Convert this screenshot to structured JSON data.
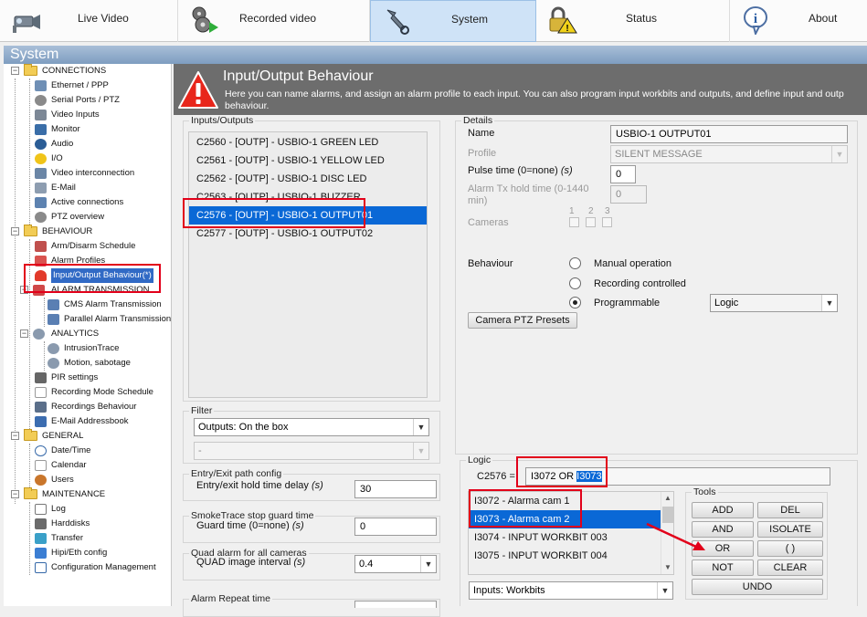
{
  "nav": {
    "tabs": [
      {
        "label": "Live Video",
        "icon": "camera-icon"
      },
      {
        "label": "Recorded video",
        "icon": "film-reel-icon"
      },
      {
        "label": "System",
        "icon": "wrench-icon"
      },
      {
        "label": "Status",
        "icon": "padlock-warning-icon"
      },
      {
        "label": "About",
        "icon": "info-bubble-icon"
      }
    ],
    "active": "System"
  },
  "system_title": "System",
  "tree": {
    "groups": [
      {
        "label": "CONNECTIONS",
        "items": [
          "Ethernet / PPP",
          "Serial Ports / PTZ",
          "Video Inputs",
          "Monitor",
          "Audio",
          "I/O",
          "Video interconnection",
          "E-Mail",
          "Active connections",
          "PTZ overview"
        ]
      },
      {
        "label": "BEHAVIOUR",
        "items": [
          "Arm/Disarm Schedule",
          "Alarm Profiles",
          "Input/Output Behaviour(*)",
          "ALARM TRANSMISSION",
          "CMS Alarm Transmission",
          "Parallel Alarm Transmission",
          "ANALYTICS",
          "IntrusionTrace",
          "Motion, sabotage",
          "PIR settings",
          "Recording Mode Schedule",
          "Recordings Behaviour",
          "E-Mail Addressbook"
        ]
      },
      {
        "label": "GENERAL",
        "items": [
          "Date/Time",
          "Calendar",
          "Users"
        ]
      },
      {
        "label": "MAINTENANCE",
        "items": [
          "Log",
          "Harddisks",
          "Transfer",
          "Hipi/Eth config",
          "Configuration Management"
        ]
      }
    ],
    "selected": "Input/Output Behaviour(*)"
  },
  "header": {
    "title": "Input/Output Behaviour",
    "description": "Here you can name alarms, and assign an alarm profile to each input. You can also program input workbits and outputs, and define input and outp behaviour."
  },
  "io": {
    "group_label": "Inputs/Outputs",
    "items": [
      "C2560 - [OUTP] - USBIO-1 GREEN LED",
      "C2561 - [OUTP] - USBIO-1 YELLOW LED",
      "C2562 - [OUTP] - USBIO-1 DISC LED",
      "C2563 - [OUTP] - USBIO-1 BUZZER",
      "C2576 - [OUTP] - USBIO-1 OUTPUT01",
      "C2577 - [OUTP] - USBIO-1 OUTPUT02"
    ],
    "selected_index": 4
  },
  "filter": {
    "group_label": "Filter",
    "primary": "Outputs: On the box",
    "secondary": "-"
  },
  "entry_exit": {
    "group_label": "Entry/Exit path config",
    "label": "Entry/exit hold time delay",
    "unit": "(s)",
    "value": "30"
  },
  "smoketrace": {
    "group_label": "SmokeTrace stop guard time",
    "label": "Guard time (0=none)",
    "unit": "(s)",
    "value": "0"
  },
  "quad": {
    "group_label": "Quad alarm for all cameras",
    "label": "QUAD image interval",
    "unit": "(s)",
    "value": "0.4"
  },
  "alarm_repeat": {
    "group_label": "Alarm Repeat time"
  },
  "details": {
    "group_label": "Details",
    "name_label": "Name",
    "name_value": "USBIO-1 OUTPUT01",
    "profile_label": "Profile",
    "profile_value": "SILENT MESSAGE",
    "pulse_label": "Pulse time (0=none)",
    "pulse_unit": "(s)",
    "pulse_value": "0",
    "alarm_tx_label": "Alarm Tx hold time (0-1440 min)",
    "alarm_tx_value": "0",
    "cameras_label": "Cameras",
    "camera_numbers": [
      "1",
      "2",
      "3"
    ],
    "behaviour_label": "Behaviour",
    "behaviour_options": [
      "Manual operation",
      "Recording controlled",
      "Programmable"
    ],
    "behaviour_selected": "Programmable",
    "behaviour_combo": "Logic",
    "ptz_button": "Camera PTZ Presets"
  },
  "logic": {
    "group_label": "Logic",
    "expr_label": "C2576 =",
    "expr_plain": "I3072 OR ",
    "expr_selected": "I3073",
    "items": [
      "I3072 - Alarma cam 1",
      "I3073 - Alarma cam 2",
      "I3074 - INPUT WORKBIT 003",
      "I3075 - INPUT WORKBIT 004"
    ],
    "selected_index": 1,
    "source": "Inputs: Workbits"
  },
  "tools": {
    "group_label": "Tools",
    "buttons": [
      "ADD",
      "DEL",
      "AND",
      "ISOLATE",
      "OR",
      "( )",
      "NOT",
      "CLEAR",
      "UNDO"
    ]
  },
  "colors": {
    "highlight": "#0a68d6",
    "annotation": "#e2001a",
    "header_bg": "#6d6d6d"
  }
}
